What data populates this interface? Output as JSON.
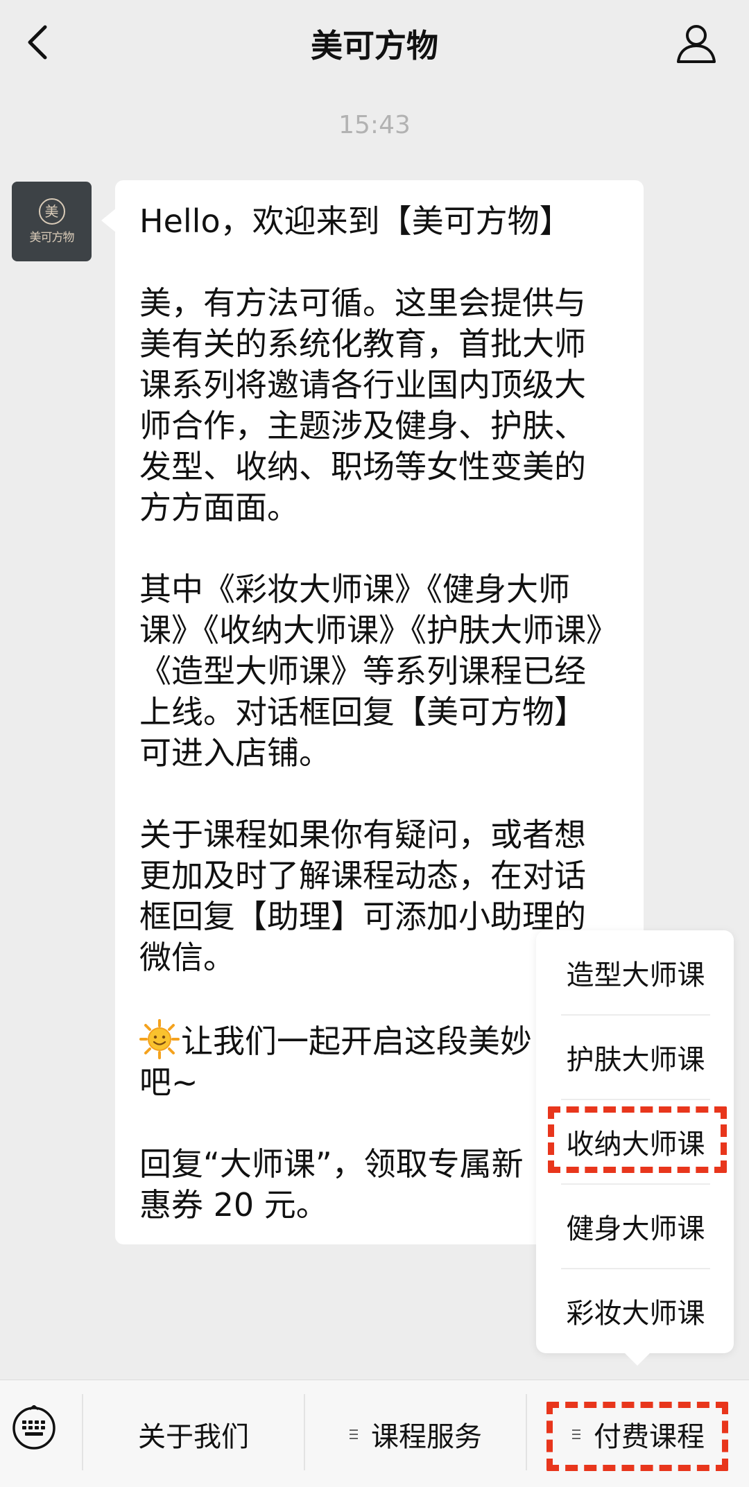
{
  "header": {
    "title": "美可方物"
  },
  "timestamp": "15:43",
  "avatar": {
    "emblem": "美",
    "label": "美可方物"
  },
  "message": {
    "paragraphs": [
      "Hello，欢迎来到【美可方物】",
      "美，有方法可循。这里会提供与美有关的系统化教育，首批大师课系列将邀请各行业国内顶级大师合作，主题涉及健身、护肤、发型、收纳、职场等女性变美的方方面面。",
      "其中《彩妆大师课》《健身大师课》《收纳大师课》《护肤大师课》《造型大师课》等系列课程已经上线。对话框回复【美可方物】可进入店铺。",
      "关于课程如果你有疑问，或者想更加及时了解课程动态，在对话框回复【助理】可添加小助理的微信。",
      "让我们一起开启这段美妙",
      "吧~",
      "回复“大师课”，领取专属新",
      "惠券 20 元。"
    ]
  },
  "popup_menu": {
    "items": [
      "造型大师课",
      "护肤大师课",
      "收纳大师课",
      "健身大师课",
      "彩妆大师课"
    ]
  },
  "menu_bar": {
    "items": [
      "关于我们",
      "课程服务",
      "付费课程"
    ]
  },
  "colors": {
    "highlight": "#e8361c",
    "background": "#ededed",
    "bubble": "#ffffff"
  },
  "icons": [
    "back-chevron-icon",
    "profile-icon",
    "keyboard-icon",
    "sun-emoji-icon",
    "menu-lines-icon"
  ]
}
